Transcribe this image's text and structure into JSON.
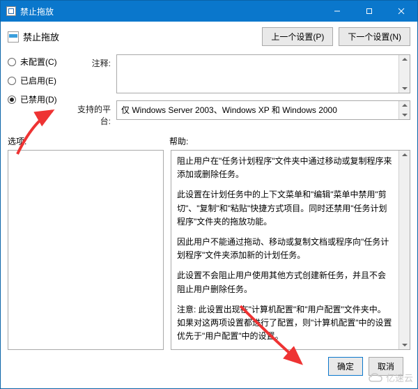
{
  "window": {
    "title": "禁止拖放"
  },
  "header": {
    "title": "禁止拖放"
  },
  "nav": {
    "prev": "上一个设置(P)",
    "next": "下一个设置(N)"
  },
  "radios": {
    "not_configured": "未配置(C)",
    "enabled": "已启用(E)",
    "disabled": "已禁用(D)",
    "selected": "disabled"
  },
  "fields": {
    "comment_label": "注释:",
    "comment_value": "",
    "platform_label": "支持的平台:",
    "platform_value": "仅 Windows Server 2003、Windows XP 和 Windows 2000"
  },
  "panes": {
    "options_label": "选项:",
    "help_label": "帮助:",
    "help_paragraphs": [
      "阻止用户在\"任务计划程序\"文件夹中通过移动或复制程序来添加或删除任务。",
      "此设置在计划任务中的上下文菜单和\"编辑\"菜单中禁用\"剪切\"、\"复制\"和\"粘贴\"快捷方式项目。同时还禁用\"任务计划程序\"文件夹的拖放功能。",
      "因此用户不能通过拖动、移动或复制文档或程序向\"任务计划程序\"文件夹添加新的计划任务。",
      "此设置不会阻止用户使用其他方式创建新任务，并且不会阻止用户删除任务。",
      "注意: 此设置出现在\"计算机配置\"和\"用户配置\"文件夹中。如果对这两项设置都进行了配置，则\"计算机配置\"中的设置优先于\"用户配置\"中的设置。"
    ]
  },
  "buttons": {
    "ok": "确定",
    "cancel": "取消"
  },
  "watermark": "亿速云"
}
